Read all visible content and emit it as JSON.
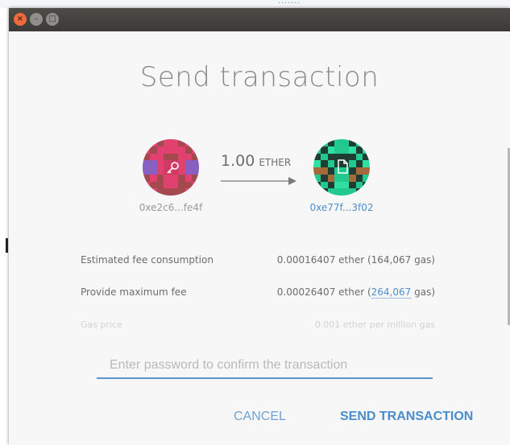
{
  "window": {
    "title_buttons": [
      {
        "name": "close",
        "glyph": "×"
      },
      {
        "name": "minimize",
        "glyph": "–"
      },
      {
        "name": "maximize",
        "glyph": "□"
      }
    ]
  },
  "dialog": {
    "title": "Send transaction",
    "amount": {
      "value": "1.00",
      "unit": "ETHER"
    },
    "from": {
      "address": "0xe2c6...fe4f",
      "icon": "key-icon",
      "identicon_colors": [
        "#e0416e",
        "#a44a4e",
        "#8a5fc2",
        "#d23a66"
      ]
    },
    "to": {
      "address": "0xe77f...3f02",
      "icon": "contract-file-icon",
      "identicon_colors": [
        "#22c98f",
        "#1f3d33",
        "#a56a3b",
        "#2fe0a2"
      ]
    },
    "details": [
      {
        "label": "Estimated fee consumption",
        "value": "0.00016407 ether (164,067 gas)"
      },
      {
        "label": "Provide maximum fee",
        "value_prefix": "0.00026407 ether (",
        "value_link": "264,067",
        "value_suffix": " gas)"
      },
      {
        "label": "Gas price",
        "value": "0.001 ether per million gas"
      }
    ],
    "password": {
      "placeholder": "Enter password to confirm the transaction",
      "value": ""
    },
    "buttons": {
      "cancel": "CANCEL",
      "send": "SEND TRANSACTION"
    }
  },
  "colors": {
    "accent": "#4a8dce",
    "link": "#4f8fce",
    "titlebar": "#3b3a37",
    "close_button": "#ef6a3d"
  }
}
